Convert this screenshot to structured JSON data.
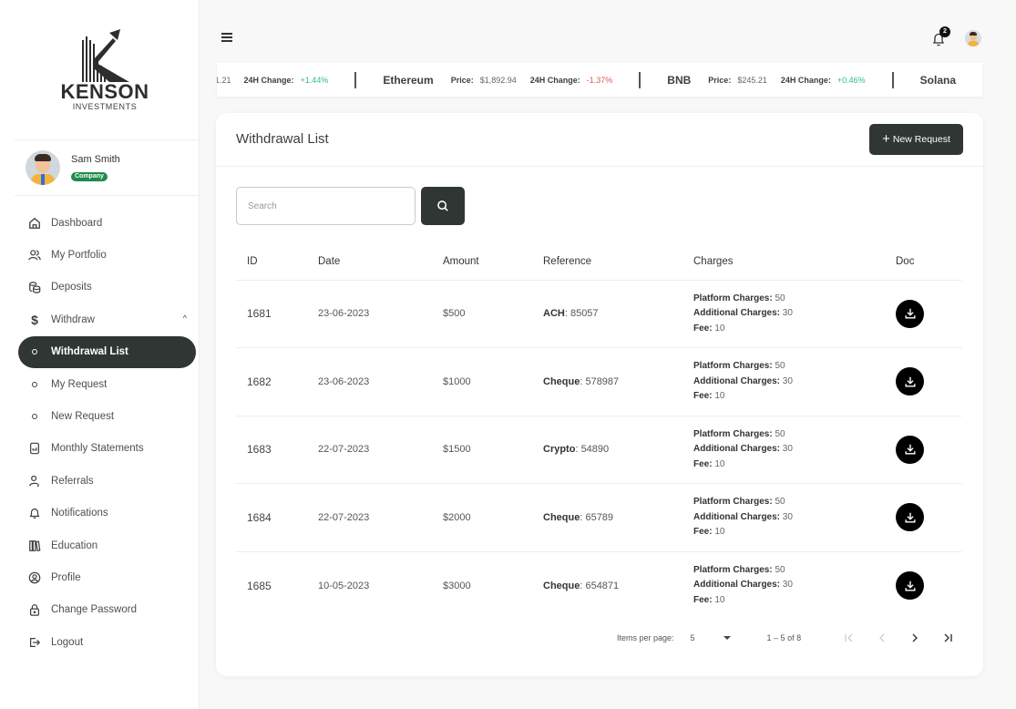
{
  "brand": {
    "name": "KENSON",
    "tagline": "INVESTMENTS"
  },
  "user": {
    "name": "Sam Smith",
    "role_badge": "Company"
  },
  "sidebar": {
    "items": [
      {
        "label": "Dashboard",
        "icon": "home-icon"
      },
      {
        "label": "My Portfolio",
        "icon": "users-icon"
      },
      {
        "label": "Deposits",
        "icon": "coins-icon"
      },
      {
        "label": "Withdraw",
        "icon": "dollar-icon",
        "expanded": true
      },
      {
        "label": "Withdrawal List",
        "sub": true,
        "active": true
      },
      {
        "label": "My Request",
        "sub": true
      },
      {
        "label": "New Request",
        "sub": true
      },
      {
        "label": "Monthly Statements",
        "icon": "statement-icon"
      },
      {
        "label": "Referrals",
        "icon": "referral-icon"
      },
      {
        "label": "Notifications",
        "icon": "bell-icon"
      },
      {
        "label": "Education",
        "icon": "books-icon"
      },
      {
        "label": "Profile",
        "icon": "profile-icon"
      },
      {
        "label": "Change Password",
        "icon": "lock-icon"
      },
      {
        "label": "Logout",
        "icon": "logout-icon"
      }
    ]
  },
  "topbar": {
    "notification_count": "2"
  },
  "ticker": {
    "lead_price_fragment": "1.21",
    "change_label": "24H Change:",
    "price_label": "Price:",
    "lead_change": "+1.44%",
    "coins": [
      {
        "name": "Ethereum",
        "price": "$1,892.94",
        "change": "-1.37%",
        "direction": "down"
      },
      {
        "name": "BNB",
        "price": "$245.21",
        "change": "+0.46%",
        "direction": "up"
      },
      {
        "name": "Solana"
      }
    ],
    "colors": {
      "up": "#2cbf8a",
      "down": "#e05b5b"
    }
  },
  "page": {
    "title": "Withdrawal List",
    "new_request_label": "New Request",
    "search_placeholder": "Search"
  },
  "table": {
    "columns": [
      "ID",
      "Date",
      "Amount",
      "Reference",
      "Charges",
      "Doc"
    ],
    "charge_labels": {
      "platform": "Platform Charges:",
      "additional": "Additional Charges:",
      "fee": "Fee:"
    },
    "rows": [
      {
        "id": "1681",
        "date": "23-06-2023",
        "amount": "$500",
        "ref_type": "ACH",
        "ref_no": ": 85057",
        "platform": " 50",
        "additional": " 30",
        "fee": " 10"
      },
      {
        "id": "1682",
        "date": "23-06-2023",
        "amount": "$1000",
        "ref_type": "Cheque",
        "ref_no": ": 578987",
        "platform": " 50",
        "additional": " 30",
        "fee": " 10"
      },
      {
        "id": "1683",
        "date": "22-07-2023",
        "amount": "$1500",
        "ref_type": "Crypto",
        "ref_no": ": 54890",
        "platform": " 50",
        "additional": " 30",
        "fee": " 10"
      },
      {
        "id": "1684",
        "date": "22-07-2023",
        "amount": "$2000",
        "ref_type": "Cheque",
        "ref_no": ": 65789",
        "platform": " 50",
        "additional": " 30",
        "fee": " 10"
      },
      {
        "id": "1685",
        "date": "10-05-2023",
        "amount": "$3000",
        "ref_type": "Cheque",
        "ref_no": ": 654871",
        "platform": " 50",
        "additional": " 30",
        "fee": " 10"
      }
    ]
  },
  "pagination": {
    "items_per_page_label": "Items per page:",
    "items_per_page": "5",
    "range": "1 – 5 of 8"
  },
  "colors": {
    "primary_dark": "#2f3634",
    "badge_green": "#1f8a4c"
  }
}
